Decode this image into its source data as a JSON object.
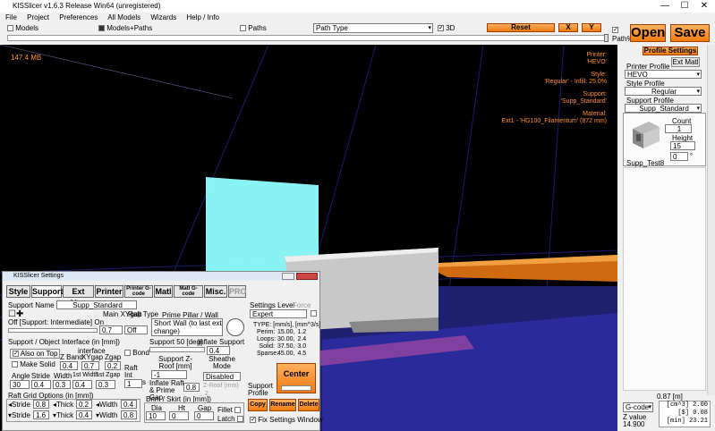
{
  "window": {
    "title": "KISSlicer v1.6.3 Release Win64 (unregistered)",
    "minimize": "—",
    "maximize": "☐",
    "close": "✕"
  },
  "menu": [
    "File",
    "Project",
    "Preferences",
    "All Models",
    "Wizards",
    "Help / Info"
  ],
  "toolbar": {
    "models": "Models",
    "models_paths": "Models+Paths",
    "paths": "Paths",
    "path_type": "Path Type",
    "three_d": "3D",
    "reset": "Reset",
    "x": "X",
    "y": "Y",
    "path_pct": "Path%"
  },
  "buttons": {
    "open": "Open",
    "save": "Save",
    "profile_settings": "Profile Settings",
    "ext_matl": "Ext Matl"
  },
  "viewport": {
    "memory": "147.4 MB",
    "info": [
      {
        "label": "Printer:",
        "value": "'HEVO'"
      },
      {
        "label": "Style:",
        "value": "'Regular' - Infill: 25.0%"
      },
      {
        "label": "Support:",
        "value": "'Supp_Standard'"
      },
      {
        "label": "Material:",
        "value": "Ext1 - 'HG100_Filamentum' (872 mm)"
      }
    ]
  },
  "right_panel": {
    "printer_profile_label": "Printer Profile",
    "printer_profile": "HEVO",
    "style_profile_label": "Style Profile",
    "style_profile": "Regular",
    "support_profile_label": "Support Profile",
    "support_profile": "Supp_Standard",
    "count_label": "Count",
    "count": "1",
    "height_label": "Height",
    "height": "15",
    "angle": "0",
    "degree": "°",
    "model_name": "Supp_Test8",
    "dimension": "0.87 [m]",
    "gcode": "G-code",
    "z_label": "Z value",
    "z_value": "14.900",
    "stats": [
      "[cm^3] 2.00",
      "[$] 0.08",
      "[min] 23.21"
    ]
  },
  "settings": {
    "title": "KISSlicer Settings",
    "tabs": [
      "Style",
      "Support",
      "Ext Map",
      "Printer",
      "Printer G-code",
      "Matl",
      "Matl G-code",
      "Misc.",
      "PRO"
    ],
    "support_name_label": "Support Name",
    "support_name": "Supp_Standard",
    "main_xygap_label": "Main XYgap",
    "main_xygap": "0.7",
    "raft_type_label": "Raft Type",
    "raft_type": "Off",
    "prime_pillar_label": "Prime Pillar / Wall",
    "prime_pillar": "Short Wall (to last ext change)",
    "off_on_label": "Off [Support: Intermediate] On",
    "interface_label": "Support / Object Interface (in [mm])",
    "also_on_top": "Also on Top",
    "make_solid": "Make Solid",
    "bond": "Bond",
    "interface_sub": "interface",
    "zband_label": "Z Band",
    "zband": "0.4",
    "xygap_label": "XYgap",
    "xygap": "0.7",
    "zgap_label": "Zgap",
    "zgap": "0.2",
    "angle_label": "Angle",
    "angle": "30",
    "stride_label": "Stride",
    "stride": "0.4",
    "width_label": "Width",
    "width": "0.3",
    "fwidth_label": "1st Width",
    "fwidth": "0.4",
    "fzgap_label": "1st Zgap",
    "fzgap": "0.3",
    "raft_int_label": "Raft Int Layers",
    "raft_int": "1",
    "support_deg_label": "Support 50 [deg]",
    "inflate_label": "Inflate Support",
    "inflate": "0.4",
    "zroof_label": "Support Z-Roof [mm]",
    "zroof": "-1",
    "inflate_raft_label": "Inflate Raft & Prime Gap",
    "inflate_raft": "0.8",
    "sheathe_label": "Sheathe Mode",
    "sheathe": "Disabled",
    "zroof2": "Z-Roof (mm)",
    "zroof2_val": "2",
    "brim_label": "Brim / Skirt (in [mm])",
    "dia_label": "Dia",
    "dia": "10",
    "ht_label": "Ht",
    "ht": "0",
    "gap_label": "Gap",
    "gap": "0",
    "fillet": "Fillet",
    "latch": "Latch",
    "raft_grid_label": "Raft Grid Options (in [mm])",
    "grid": [
      {
        "stride": "0.8",
        "thick": "0.2",
        "width": "0.4"
      },
      {
        "stride": "1.6",
        "thick": "0.4",
        "width": "0.8"
      }
    ],
    "stride_lbl": "Stride",
    "thick_lbl": "Thick",
    "width_lbl": "Width",
    "settings_level_label": "Settings Level",
    "force_label": "Force",
    "settings_level": "Expert",
    "type_header": "TYPE: [mm/s], [mm^3/s]",
    "speeds": [
      {
        "type": "Perim:",
        "a": "15.00,",
        "b": "1.2"
      },
      {
        "type": "Loops:",
        "a": "30.00,",
        "b": "2.4"
      },
      {
        "type": "Solid:",
        "a": "37.50,",
        "b": "3.0"
      },
      {
        "type": "Sparse:",
        "a": "45.00,",
        "b": "4.5"
      }
    ],
    "center": "Center",
    "support_profile": "Support Profile",
    "copy": "Copy",
    "rename": "Rename",
    "delete": "Delete",
    "fix_window": "Fix Settings Window"
  }
}
